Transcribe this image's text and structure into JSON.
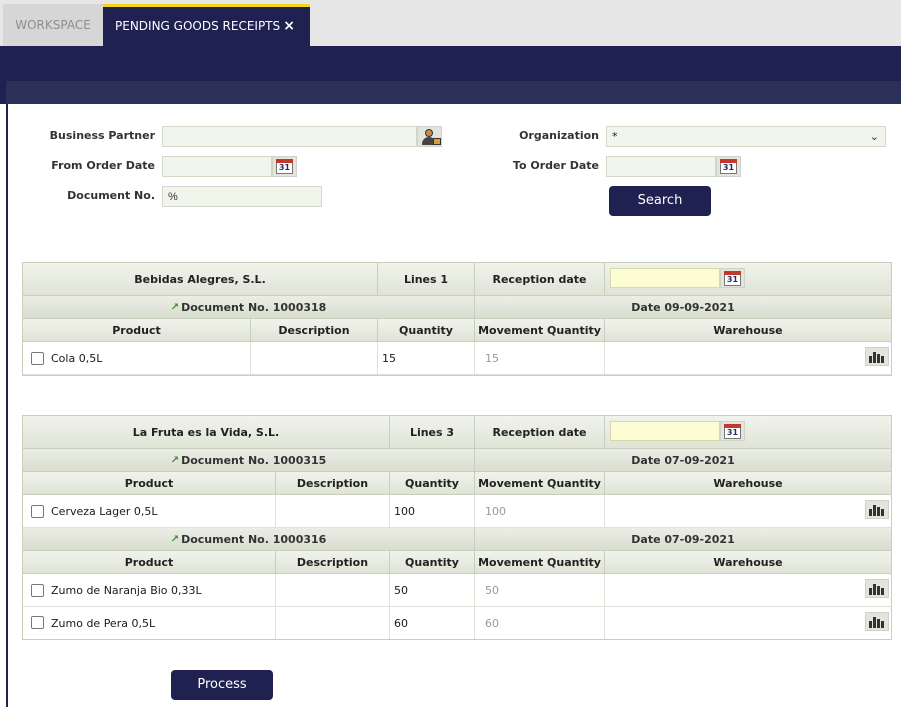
{
  "tabs": {
    "workspace": "WORKSPACE",
    "active": "PENDING GOODS RECEIPTS",
    "close_glyph": "×"
  },
  "form": {
    "business_partner_label": "Business Partner",
    "business_partner_value": "",
    "organization_label": "Organization",
    "organization_value": "*",
    "from_date_label": "From Order Date",
    "from_date_value": "",
    "to_date_label": "To Order Date",
    "to_date_value": "",
    "doc_no_label": "Document No.",
    "doc_no_value": "%",
    "search_label": "Search",
    "calendar_glyph": "31"
  },
  "columns": {
    "product": "Product",
    "description": "Description",
    "quantity": "Quantity",
    "movement_quantity": "Movement Quantity",
    "warehouse": "Warehouse",
    "lines": "Lines",
    "reception_date": "Reception date"
  },
  "groups": [
    {
      "partner": "Bebidas Alegres, S.L.",
      "lines_label": "Lines 1",
      "reception_date_value": "",
      "documents": [
        {
          "doc_label": "Document No. 1000318",
          "date_label": "Date 09-09-2021",
          "rows": [
            {
              "product": "Cola 0,5L",
              "description": "",
              "quantity": "15",
              "movement_quantity": "15",
              "warehouse": ""
            }
          ]
        }
      ]
    },
    {
      "partner": "La Fruta es la Vida, S.L.",
      "lines_label": "Lines 3",
      "reception_date_value": "",
      "documents": [
        {
          "doc_label": "Document No. 1000315",
          "date_label": "Date 07-09-2021",
          "rows": [
            {
              "product": "Cerveza Lager 0,5L",
              "description": "",
              "quantity": "100",
              "movement_quantity": "100",
              "warehouse": ""
            }
          ]
        },
        {
          "doc_label": "Document No. 1000316",
          "date_label": "Date 07-09-2021",
          "rows": [
            {
              "product": "Zumo de Naranja Bio 0,33L",
              "description": "",
              "quantity": "50",
              "movement_quantity": "50",
              "warehouse": ""
            },
            {
              "product": "Zumo de Pera 0,5L",
              "description": "",
              "quantity": "60",
              "movement_quantity": "60",
              "warehouse": ""
            }
          ]
        }
      ]
    }
  ],
  "process_label": "Process",
  "colors": {
    "navy": "#1f2250",
    "tab_accent": "#f6d31c",
    "date_input_bg": "#fdfdd3"
  },
  "icons": {
    "partner_selector": "partner-selector-icon",
    "calendar": "calendar-icon",
    "warehouse": "warehouse-icon",
    "doc_arrow": "arrow-icon",
    "dropdown": "chevron-down-icon"
  }
}
